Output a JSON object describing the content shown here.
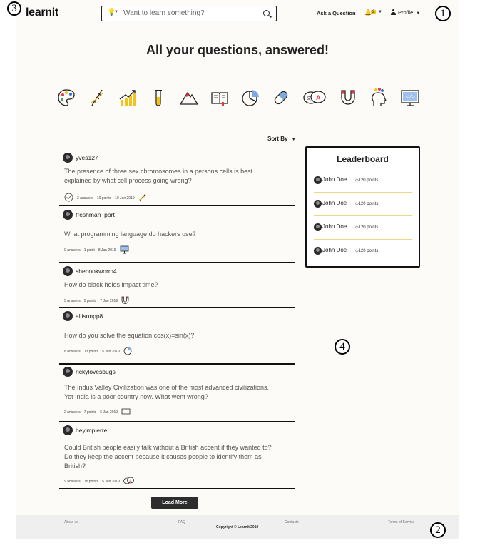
{
  "app": {
    "logo": "learnit",
    "search_placeholder": "Want to learn something?",
    "nav": {
      "ask": "Ask a Question",
      "notif_count": "2",
      "profile": "Profile"
    }
  },
  "markers": [
    "1",
    "2",
    "3",
    "4"
  ],
  "hero": {
    "title": "All your questions, answered!"
  },
  "categories": [
    "palette-icon",
    "dna-icon",
    "chart-growth-icon",
    "test-tube-icon",
    "mountain-icon",
    "book-icon",
    "pie-chart-icon",
    "pill-icon",
    "language-bubbles-icon",
    "magnet-icon",
    "head-gears-icon",
    "computer-code-icon"
  ],
  "sort_label": "Sort By",
  "questions": [
    {
      "user": "yves127",
      "text": "The presence of three sex chromosomes in a persons cells is best explained by what cell process going wrong?",
      "answers": "3 answers",
      "points": "10 points",
      "date": "10 Jan 2019",
      "icon": "dna-icon"
    },
    {
      "user": "freshman_port",
      "text": "What programming language do hackers use?",
      "answers": "0 answers",
      "points": "1 point",
      "date": "8 Jan 2019",
      "icon": "computer-code-icon"
    },
    {
      "user": "shebookworm4",
      "text": "How do black holes impact time?",
      "answers": "5 answers",
      "points": "5 points",
      "date": "7 Jan 2019",
      "icon": "magnet-icon"
    },
    {
      "user": "allisonpp8",
      "text": "How do you solve the equation cos(x)=sin(x)?",
      "answers": "8 answers",
      "points": "13 points",
      "date": "5 Jan 2019",
      "icon": "pie-chart-icon"
    },
    {
      "user": "rickylovesbugs",
      "text": "The Indus Valley Civilization was one of the most advanced civilizations. Yet India is a poor country now. What went wrong?",
      "answers": "2 answers",
      "points": "7 points",
      "date": "5 Jan 2019",
      "icon": "book-icon"
    },
    {
      "user": "heyimpierre",
      "text": "Could British people easily talk without a British accent if they wanted to? Do they keep the accent because it causes people to identify them as British?",
      "answers": "9 answers",
      "points": "15 points",
      "date": "5 Jan 2019",
      "icon": "language-bubbles-icon"
    }
  ],
  "leaderboard": {
    "title": "Leaderboard",
    "entries": [
      {
        "name": "John Doe",
        "points": "120 points"
      },
      {
        "name": "John Doe",
        "points": "120 points"
      },
      {
        "name": "John Doe",
        "points": "120 points"
      },
      {
        "name": "John Doe",
        "points": "120 points"
      }
    ]
  },
  "load_more": "Load More",
  "footer": {
    "about": "About us",
    "faq": "FAQ",
    "contacts": "Contacts",
    "terms": "Terms of Service",
    "copyright": "Copyright © Learnit 2019"
  },
  "colors": {
    "accent": "#f2c31a",
    "dark": "#2d2d2d",
    "page_bg": "#fcfbf7"
  }
}
